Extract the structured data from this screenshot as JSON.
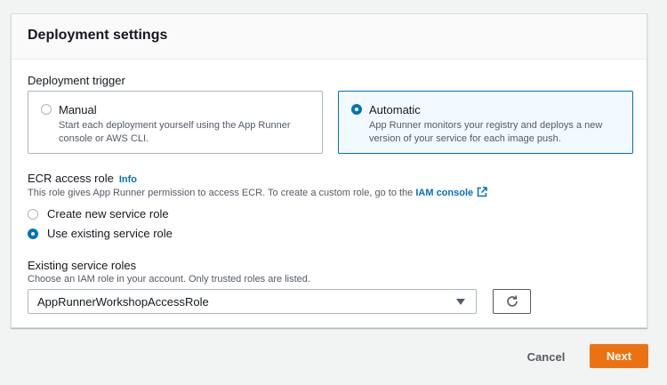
{
  "panel": {
    "title": "Deployment settings"
  },
  "deployment_trigger": {
    "label": "Deployment trigger",
    "options": [
      {
        "title": "Manual",
        "description": "Start each deployment yourself using the App Runner console or AWS CLI.",
        "selected": false
      },
      {
        "title": "Automatic",
        "description": "App Runner monitors your registry and deploys a new version of your service for each image push.",
        "selected": true
      }
    ]
  },
  "ecr_access_role": {
    "label": "ECR access role",
    "info_link": "Info",
    "description_prefix": "This role gives App Runner permission to access ECR. To create a custom role, go to the",
    "iam_link": "IAM console",
    "options": [
      {
        "label": "Create new service role",
        "selected": false
      },
      {
        "label": "Use existing service role",
        "selected": true
      }
    ]
  },
  "existing_roles": {
    "label": "Existing service roles",
    "description": "Choose an IAM role in your account. Only trusted roles are listed.",
    "selected_value": "AppRunnerWorkshopAccessRole"
  },
  "footer": {
    "cancel_label": "Cancel",
    "next_label": "Next"
  },
  "colors": {
    "accent": "#0073bb",
    "primary_button": "#ec7211"
  },
  "icons": [
    "external-link-icon",
    "refresh-icon",
    "caret-down-icon"
  ]
}
